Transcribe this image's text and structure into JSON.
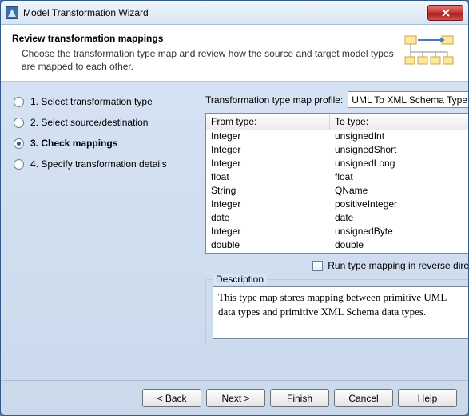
{
  "window": {
    "title": "Model Transformation Wizard"
  },
  "header": {
    "title": "Review transformation mappings",
    "desc": "Choose the transformation type map and review how the source and target model types are mapped to each other."
  },
  "steps": [
    {
      "label": "1. Select transformation type",
      "selected": false
    },
    {
      "label": "2. Select source/destination",
      "selected": false
    },
    {
      "label": "3. Check mappings",
      "selected": true
    },
    {
      "label": "4. Specify transformation details",
      "selected": false
    }
  ],
  "profile": {
    "label": "Transformation type map profile:",
    "value": "UML To XML Schema Type ..."
  },
  "table": {
    "headers": {
      "from": "From type:",
      "to": "To type:"
    },
    "rows": [
      {
        "from": "Integer",
        "to": "unsignedInt"
      },
      {
        "from": "Integer",
        "to": "unsignedShort"
      },
      {
        "from": "Integer",
        "to": "unsignedLong"
      },
      {
        "from": "float",
        "to": "float"
      },
      {
        "from": "String",
        "to": "QName"
      },
      {
        "from": "Integer",
        "to": "positiveInteger"
      },
      {
        "from": "date",
        "to": "date"
      },
      {
        "from": "Integer",
        "to": "unsignedByte"
      },
      {
        "from": "double",
        "to": "double"
      }
    ]
  },
  "reverse": {
    "label": "Run type mapping in reverse direction",
    "checked": false
  },
  "description": {
    "legend": "Description",
    "text": "This type map stores mapping between primitive UML data types and primitive XML Schema data types."
  },
  "buttons": {
    "back": "< Back",
    "next": "Next >",
    "finish": "Finish",
    "cancel": "Cancel",
    "help": "Help"
  }
}
